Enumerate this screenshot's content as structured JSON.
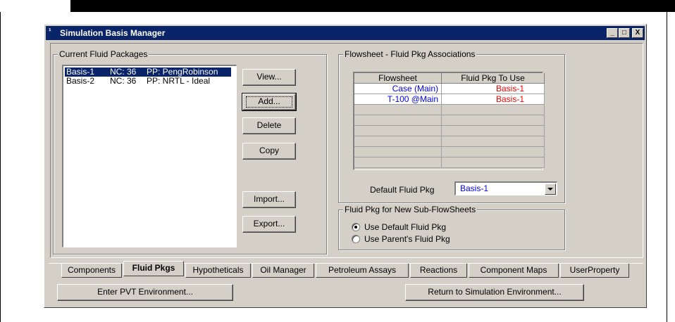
{
  "window": {
    "title": "Simulation Basis Manager",
    "controls": {
      "minimize": "_",
      "maximize": "□",
      "close": "X"
    }
  },
  "fluid_packages": {
    "group_label": "Current Fluid Packages",
    "items": [
      {
        "name": "Basis-1",
        "nc": "NC: 36",
        "pp": "PP: PengRobinson",
        "selected": true
      },
      {
        "name": "Basis-2",
        "nc": "NC: 36",
        "pp": "PP: NRTL - Ideal",
        "selected": false
      }
    ]
  },
  "buttons": {
    "view": "View...",
    "add": "Add...",
    "delete": "Delete",
    "copy": "Copy",
    "import": "Import...",
    "export": "Export..."
  },
  "associations": {
    "group_label": "Flowsheet - Fluid Pkg Associations",
    "columns": [
      "Flowsheet",
      "Fluid Pkg To Use"
    ],
    "rows": [
      {
        "flowsheet": "Case (Main)",
        "fluid_pkg": "Basis-1"
      },
      {
        "flowsheet": "T-100 @Main",
        "fluid_pkg": "Basis-1"
      }
    ],
    "default_label": "Default Fluid Pkg",
    "default_value": "Basis-1"
  },
  "new_subflowsheets": {
    "group_label": "Fluid Pkg for New Sub-FlowSheets",
    "options": [
      {
        "label": "Use Default Fluid Pkg",
        "checked": true
      },
      {
        "label": "Use Parent's Fluid Pkg",
        "checked": false
      }
    ]
  },
  "tabs": [
    {
      "label": "Components",
      "active": false
    },
    {
      "label": "Fluid Pkgs",
      "active": true
    },
    {
      "label": "Hypotheticals",
      "active": false
    },
    {
      "label": "Oil Manager",
      "active": false
    },
    {
      "label": "Petroleum Assays",
      "active": false
    },
    {
      "label": "Reactions",
      "active": false
    },
    {
      "label": "Component Maps",
      "active": false
    },
    {
      "label": "UserProperty",
      "active": false
    }
  ],
  "bottom_buttons": {
    "pvt": "Enter PVT Environment...",
    "return": "Return to Simulation Environment..."
  },
  "colors": {
    "titlebar": "#0a246a",
    "flowsheet_text": "#0000ff",
    "pkg_text": "#ff0000"
  }
}
